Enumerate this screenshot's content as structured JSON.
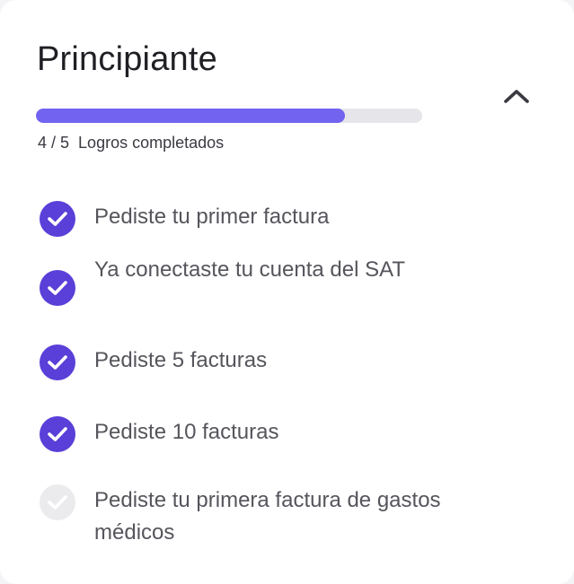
{
  "card": {
    "title": "Principiante",
    "progress": {
      "completed": 4,
      "total": 5,
      "fraction": 0.8,
      "count_text": "4 / 5",
      "label": "Logros completados"
    },
    "achievements": [
      {
        "label": "Pediste tu primer factura",
        "done": true
      },
      {
        "label": "Ya conectaste tu cuenta del SAT",
        "done": true
      },
      {
        "label": "Pediste 5 facturas",
        "done": true
      },
      {
        "label": "Pediste 10 facturas",
        "done": true
      },
      {
        "label": "Pediste tu primera factura de gastos médicos",
        "done": false
      }
    ]
  },
  "colors": {
    "accent": "#5a3fd8",
    "progress_fill": "#7263f0",
    "progress_track": "#e6e6ea",
    "pending_check": "#ebebee"
  },
  "icons": {
    "collapse": "chevron-up-icon",
    "done": "check-circle-icon",
    "pending": "check-circle-icon"
  }
}
